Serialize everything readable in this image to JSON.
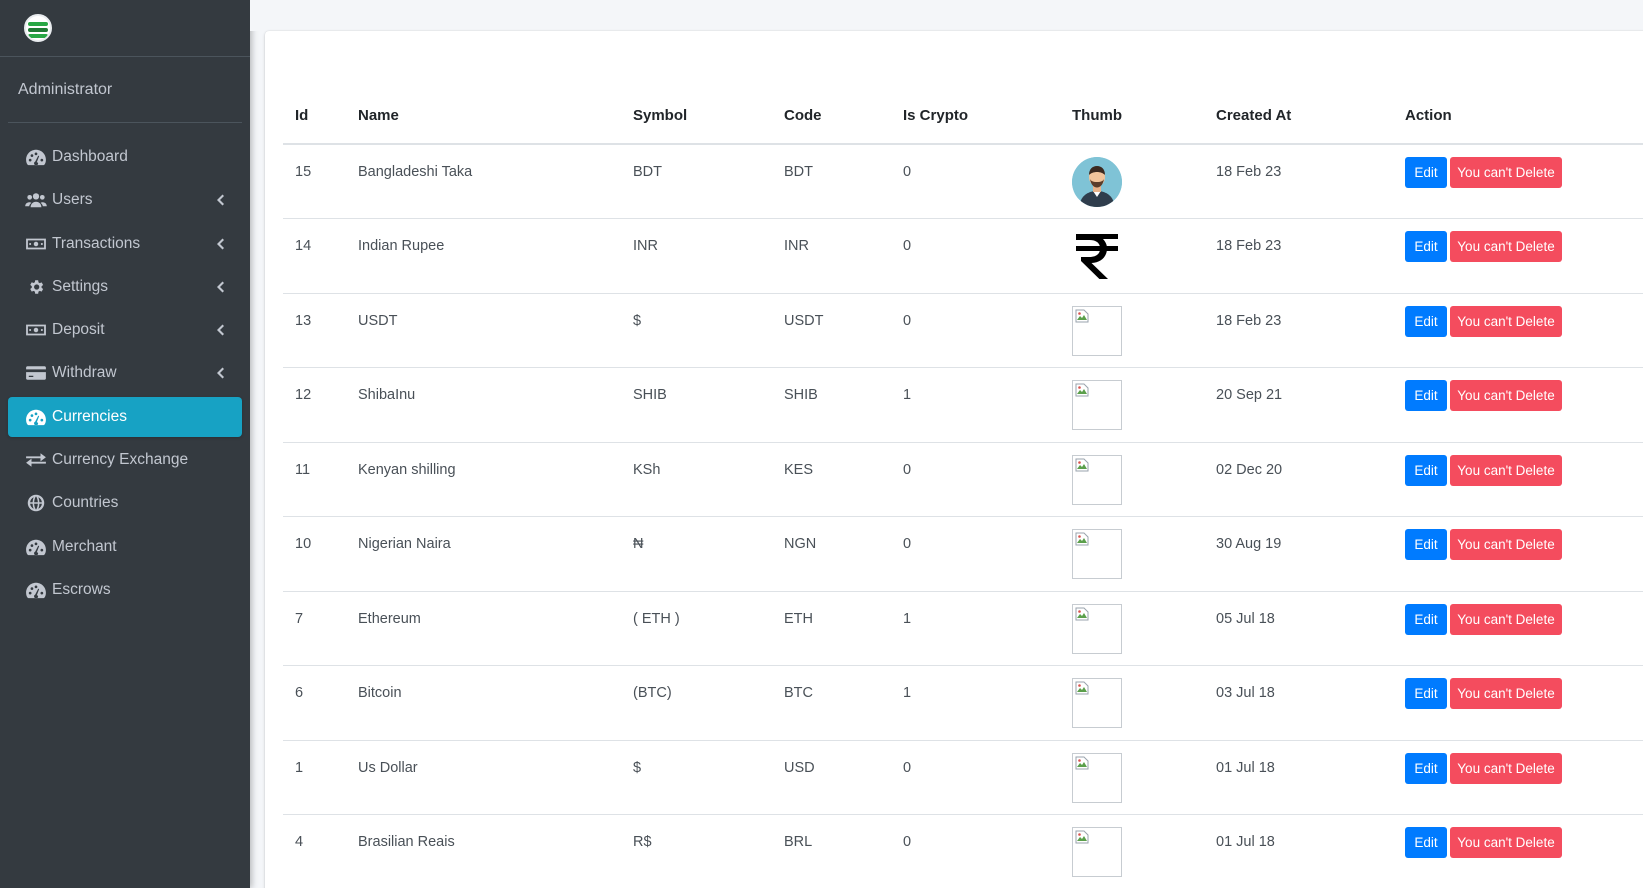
{
  "sidebar": {
    "user_name": "Administrator",
    "items": [
      {
        "label": "Dashboard",
        "icon": "dashboard-icon",
        "has_children": false,
        "active": false
      },
      {
        "label": "Users",
        "icon": "users-icon",
        "has_children": true,
        "active": false
      },
      {
        "label": "Transactions",
        "icon": "money-icon",
        "has_children": true,
        "active": false
      },
      {
        "label": "Settings",
        "icon": "gear-icon",
        "has_children": true,
        "active": false
      },
      {
        "label": "Deposit",
        "icon": "money-icon",
        "has_children": true,
        "active": false
      },
      {
        "label": "Withdraw",
        "icon": "credit-card-icon",
        "has_children": true,
        "active": false
      },
      {
        "label": "Currencies",
        "icon": "dashboard-icon",
        "has_children": false,
        "active": true
      },
      {
        "label": "Currency Exchange",
        "icon": "exchange-icon",
        "has_children": false,
        "active": false
      },
      {
        "label": "Countries",
        "icon": "globe-icon",
        "has_children": false,
        "active": false
      },
      {
        "label": "Merchant",
        "icon": "dashboard-icon",
        "has_children": false,
        "active": false
      },
      {
        "label": "Escrows",
        "icon": "dashboard-icon",
        "has_children": false,
        "active": false
      }
    ]
  },
  "table": {
    "headers": {
      "id": "Id",
      "name": "Name",
      "symbol": "Symbol",
      "code": "Code",
      "is_crypto": "Is Crypto",
      "thumb": "Thumb",
      "created_at": "Created At",
      "action": "Action"
    },
    "edit_label": "Edit",
    "delete_label": "You can't Delete",
    "rows": [
      {
        "id": "15",
        "name": "Bangladeshi Taka",
        "symbol": "BDT",
        "code": "BDT",
        "is_crypto": "0",
        "created_at": "18 Feb 23",
        "thumb": "avatar"
      },
      {
        "id": "14",
        "name": "Indian Rupee",
        "symbol": "INR",
        "code": "INR",
        "is_crypto": "0",
        "created_at": "18 Feb 23",
        "thumb": "rupee"
      },
      {
        "id": "13",
        "name": "USDT",
        "symbol": "$",
        "code": "USDT",
        "is_crypto": "0",
        "created_at": "18 Feb 23",
        "thumb": "broken"
      },
      {
        "id": "12",
        "name": "ShibaInu",
        "symbol": "SHIB",
        "code": "SHIB",
        "is_crypto": "1",
        "created_at": "20 Sep 21",
        "thumb": "broken"
      },
      {
        "id": "11",
        "name": "Kenyan shilling",
        "symbol": "KSh",
        "code": "KES",
        "is_crypto": "0",
        "created_at": "02 Dec 20",
        "thumb": "broken"
      },
      {
        "id": "10",
        "name": "Nigerian Naira",
        "symbol": "₦",
        "code": "NGN",
        "is_crypto": "0",
        "created_at": "30 Aug 19",
        "thumb": "broken"
      },
      {
        "id": "7",
        "name": "Ethereum",
        "symbol": "( ETH )",
        "code": "ETH",
        "is_crypto": "1",
        "created_at": "05 Jul 18",
        "thumb": "broken"
      },
      {
        "id": "6",
        "name": "Bitcoin",
        "symbol": "(BTC)",
        "code": "BTC",
        "is_crypto": "1",
        "created_at": "03 Jul 18",
        "thumb": "broken"
      },
      {
        "id": "1",
        "name": "Us Dollar",
        "symbol": "$",
        "code": "USD",
        "is_crypto": "0",
        "created_at": "01 Jul 18",
        "thumb": "broken"
      },
      {
        "id": "4",
        "name": "Brasilian Reais",
        "symbol": "R$",
        "code": "BRL",
        "is_crypto": "0",
        "created_at": "01 Jul 18",
        "thumb": "broken"
      }
    ]
  },
  "colors": {
    "sidebar_bg": "#343a40",
    "active_item": "#17a2c4",
    "edit_button": "#007bff",
    "delete_button": "#f44c5e"
  }
}
